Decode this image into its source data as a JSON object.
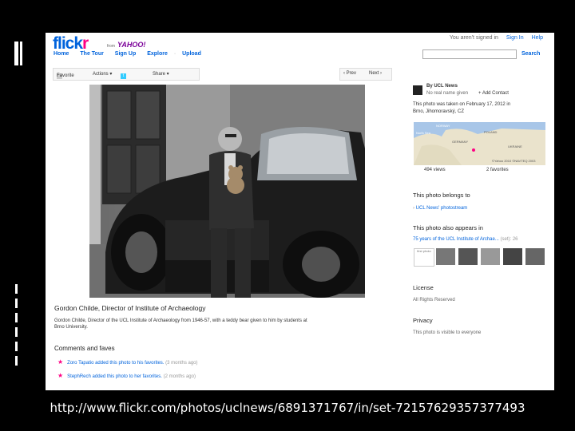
{
  "page": {
    "url_text": "http://www.flickr.com/photos/uclnews/6891371767/in/set-72157629357377493"
  },
  "header": {
    "logo_a": "flick",
    "logo_b": "r",
    "yahoo_from": "from",
    "yahoo": "YAHOO!",
    "signed_status": "You aren't signed in",
    "sign_in": "Sign In",
    "help": "Help",
    "search_label": "Search"
  },
  "nav": [
    {
      "label": "Home"
    },
    {
      "label": "The Tour"
    },
    {
      "label": "Sign Up"
    },
    {
      "label": "Explore"
    },
    {
      "label": "Upload"
    }
  ],
  "toolbar": {
    "favorite": "Favorite",
    "actions": "Actions ▾",
    "share": "Share ▾",
    "prev": "‹ Prev",
    "next": "Next ›"
  },
  "owner": {
    "by": "By UCL News",
    "note": "No real name given",
    "add_contact": "+ Add Contact"
  },
  "taken": {
    "line1": "This photo was taken on February 17, 2012 in",
    "line2": "Brno, Jihomoravský, CZ"
  },
  "map": {
    "labels": [
      "NORWAY",
      "North Sea",
      "POLAND",
      "GERMANY",
      "UKRAINE"
    ],
    "credit": "©Yahoo 2010 ©NAVTEQ 2003",
    "views": "494 views",
    "favorites": "2 favorites"
  },
  "belongs": {
    "heading": "This photo belongs to",
    "stream": "UCL News' photostream"
  },
  "appears": {
    "heading": "This photo also appears in",
    "set": "75 years of the UCL Institute of Archae...",
    "set_count": "(set): 26",
    "first_photo": "first photo"
  },
  "license": {
    "heading": "License",
    "text": "All Rights Reserved"
  },
  "privacy": {
    "heading": "Privacy",
    "text": "This photo is visible to everyone"
  },
  "caption": {
    "title": "Gordon Childe, Director of Institute of Archaeology",
    "body": "Gordon Childe, Director of the UCL Institute of Archaeology from 1946-57, with a teddy bear given to him by students at Brno University."
  },
  "comments": {
    "heading": "Comments and faves",
    "items": [
      {
        "text": "Zoro Tapatio added this photo to his favorites.",
        "ago": "(3 months ago)"
      },
      {
        "text": "StephRech added this photo to her favorites.",
        "ago": "(2 months ago)"
      }
    ]
  }
}
